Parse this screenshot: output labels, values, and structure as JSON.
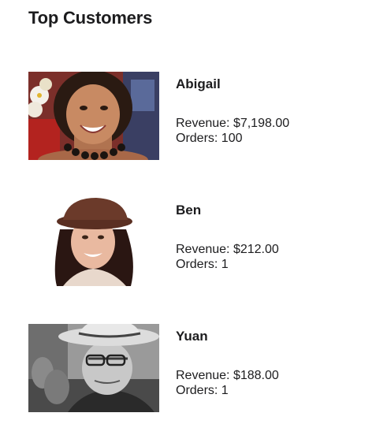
{
  "page": {
    "title": "Top Customers"
  },
  "customers": [
    {
      "name": "Abigail",
      "revenue_label": "Revenue: $7,198.00",
      "orders_label": "Orders: 100"
    },
    {
      "name": "Ben",
      "revenue_label": "Revenue: $212.00",
      "orders_label": "Orders: 1"
    },
    {
      "name": "Yuan",
      "revenue_label": "Revenue: $188.00",
      "orders_label": "Orders: 1"
    }
  ]
}
